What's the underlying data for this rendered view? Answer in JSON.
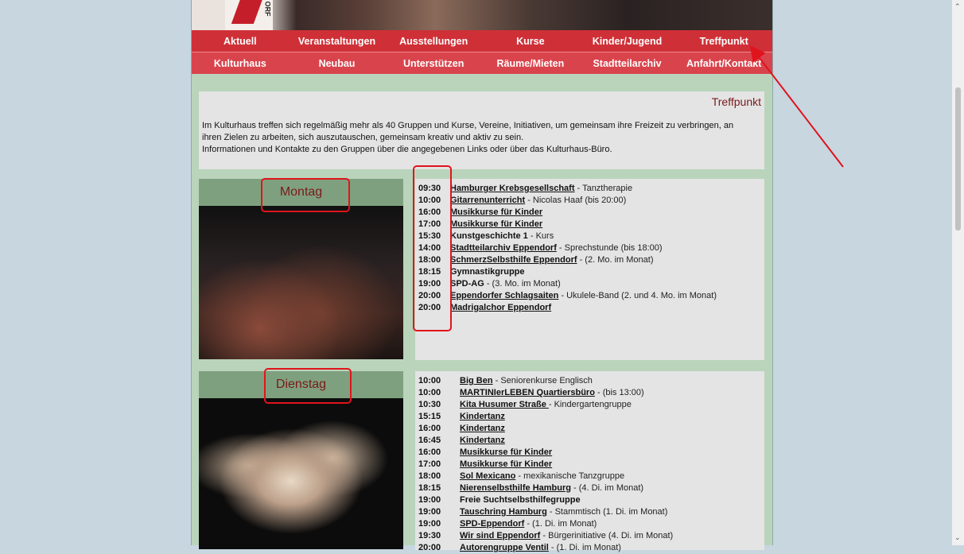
{
  "header": {
    "logo_text": "ORF"
  },
  "nav": {
    "row1": [
      "Aktuell",
      "Veranstaltungen",
      "Ausstellungen",
      "Kurse",
      "Kinder/Jugend",
      "Treffpunkt"
    ],
    "row2": [
      "Kulturhaus",
      "Neubau",
      "Unterstützen",
      "Räume/Mieten",
      "Stadtteilarchiv",
      "Anfahrt/Kontakt"
    ]
  },
  "intro": {
    "title": "Treffpunkt",
    "line1": "Im Kulturhaus treffen sich regelmäßig mehr als 40 Gruppen und Kurse, Vereine, Initiativen, um gemeinsam ihre Freizeit zu verbringen, an",
    "line2": "ihren Zielen zu arbeiten, sich auszutauschen, gemeinsam kreativ und aktiv zu sein.",
    "line3": "Informationen und Kontakte zu den Gruppen über die angegebenen Links oder über das Kulturhaus-Büro."
  },
  "days": [
    {
      "name": "Montag",
      "events": [
        {
          "time": "09:30",
          "name": "Hamburger Krebsgesellschaft",
          "link": true,
          "desc": " - Tanztherapie"
        },
        {
          "time": "10:00",
          "name": "Gitarrenunterricht",
          "link": true,
          "desc": " - Nicolas Haaf (bis 20:00)"
        },
        {
          "time": "16:00",
          "name": "Musikkurse für Kinder",
          "link": true,
          "desc": ""
        },
        {
          "time": "17:00",
          "name": "Musikkurse für Kinder",
          "link": true,
          "desc": ""
        },
        {
          "time": "15:30",
          "name": "Kunstgeschichte 1",
          "link": false,
          "desc": " - Kurs"
        },
        {
          "time": "14:00",
          "name": "Stadtteilarchiv Eppendorf",
          "link": true,
          "desc": " - Sprechstunde (bis 18:00)"
        },
        {
          "time": "18:00",
          "name": "SchmerzSelbsthilfe Eppendorf",
          "link": true,
          "desc": " - (2. Mo. im Monat)"
        },
        {
          "time": "18:15",
          "name": "Gymnastikgruppe",
          "link": false,
          "desc": ""
        },
        {
          "time": "19:00",
          "name": "SPD-AG",
          "link": false,
          "desc": " - (3. Mo. im Monat)"
        },
        {
          "time": "20:00",
          "name": "Eppendorfer Schlagsaiten",
          "link": true,
          "desc": " - Ukulele-Band (2. und 4. Mo. im Monat)"
        },
        {
          "time": "20:00",
          "name": "Madrigalchor Eppendorf",
          "link": true,
          "desc": ""
        }
      ]
    },
    {
      "name": "Dienstag",
      "events": [
        {
          "time": "10:00",
          "name": "Big Ben",
          "link": true,
          "desc": " - Seniorenkurse Englisch"
        },
        {
          "time": "10:00",
          "name": "MARTINIerLEBEN Quartiersbüro",
          "link": true,
          "desc": " - (bis 13:00)"
        },
        {
          "time": "10:30",
          "name": "Kita Husumer Straße ",
          "link": true,
          "desc": "- Kindergartengruppe"
        },
        {
          "time": "15:15",
          "name": "Kindertanz",
          "link": true,
          "desc": ""
        },
        {
          "time": "16:00",
          "name": "Kindertanz",
          "link": true,
          "desc": ""
        },
        {
          "time": "16:45",
          "name": "Kindertanz",
          "link": true,
          "desc": ""
        },
        {
          "time": "16:00",
          "name": "Musikkurse für Kinder",
          "link": true,
          "desc": ""
        },
        {
          "time": "17:00",
          "name": "Musikkurse für Kinder",
          "link": true,
          "desc": ""
        },
        {
          "time": "18:00",
          "name": "Sol Mexicano",
          "link": true,
          "desc": " - mexikanische Tanzgruppe"
        },
        {
          "time": "18:15",
          "name": "Nierenselbsthilfe Hamburg",
          "link": true,
          "desc": " - (4. Di. im Monat)"
        },
        {
          "time": "19:00",
          "name": "Freie Suchtselbsthilfegruppe",
          "link": false,
          "desc": ""
        },
        {
          "time": "19:00",
          "name": "Tauschring Hamburg",
          "link": true,
          "desc": " - Stammtisch (1. Di. im Monat)"
        },
        {
          "time": "19:00",
          "name": "SPD-Eppendorf",
          "link": true,
          "desc": " - (1. Di. im Monat)"
        },
        {
          "time": "19:30",
          "name": "Wir sind Eppendorf",
          "link": true,
          "desc": " - Bürgerinitiative (4. Di. im Monat)"
        },
        {
          "time": "20:00",
          "name": "Autorengruppe Ventil",
          "link": true,
          "desc": " - (1. Di. im Monat)"
        }
      ]
    }
  ]
}
